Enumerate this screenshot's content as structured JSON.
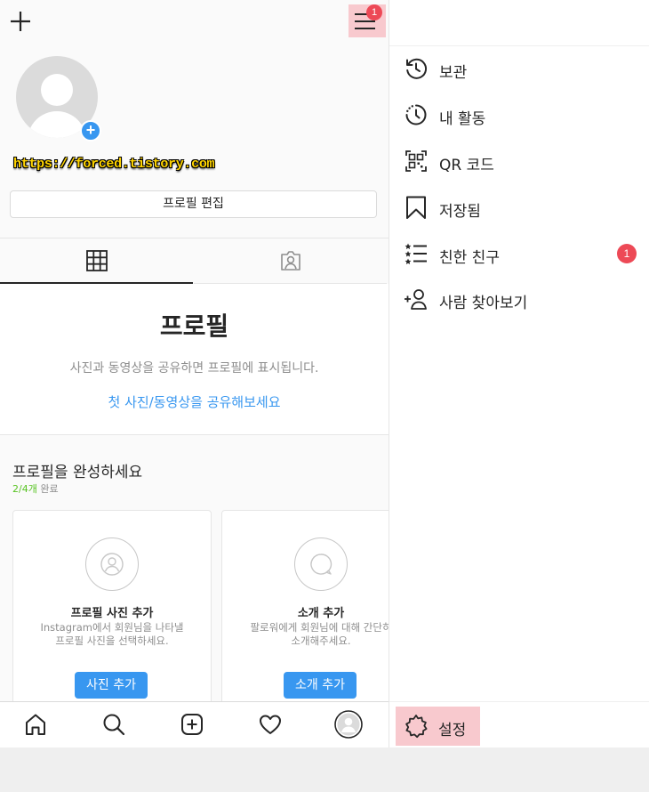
{
  "profile": {
    "watermark": "https://forced.tistory.com",
    "edit_button": "프로필 편집",
    "menu_badge": "1"
  },
  "empty_state": {
    "title": "프로필",
    "description": "사진과 동영상을 공유하면 프로필에 표시됩니다.",
    "link": "첫 사진/동영상을 공유해보세요"
  },
  "complete_profile": {
    "title": "프로필을 완성하세요",
    "progress_done": "2/4개",
    "progress_suffix": "완료",
    "cards": [
      {
        "title": "프로필 사진 추가",
        "desc_line1": "Instagram에서 회원님을 나타낼",
        "desc_line2": "프로필 사진을 선택하세요.",
        "button": "사진 추가"
      },
      {
        "title": "소개 추가",
        "desc_line1": "팔로워에게 회원님에 대해 간단히",
        "desc_line2": "소개해주세요.",
        "button": "소개 추가"
      }
    ]
  },
  "drawer": {
    "items": [
      {
        "label": "보관",
        "icon": "archive-icon"
      },
      {
        "label": "내 활동",
        "icon": "activity-icon"
      },
      {
        "label": "QR 코드",
        "icon": "qr-code-icon"
      },
      {
        "label": "저장됨",
        "icon": "bookmark-icon"
      },
      {
        "label": "친한 친구",
        "icon": "close-friends-icon",
        "badge": "1"
      },
      {
        "label": "사람 찾아보기",
        "icon": "discover-people-icon"
      }
    ],
    "settings_label": "설정"
  },
  "colors": {
    "accent_blue": "#3897f0",
    "badge_red": "#ed4956",
    "highlight_pink": "#f8c9ce",
    "progress_green": "#58c322"
  }
}
